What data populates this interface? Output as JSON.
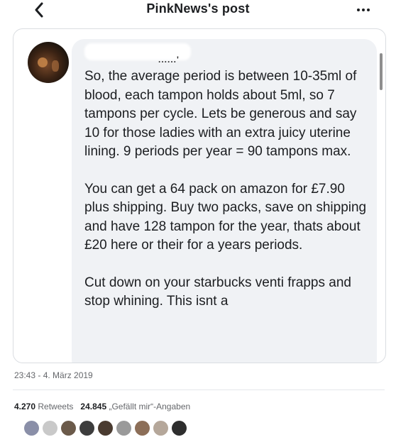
{
  "nav": {
    "back_icon": "chevron-left-icon",
    "title": "PinkNews's post",
    "more_icon": "ellipsis-icon"
  },
  "post": {
    "author_name_visible": "......'",
    "paragraphs": [
      "So, the average period is between 10-35ml of blood, each tampon holds about 5ml, so 7 tampons per cycle. Lets be generous and say 10 for those ladies with an extra juicy uterine lining. 9 periods per year = 90 tampons max.",
      "You can get a 64 pack on amazon for £7.90 plus shipping. Buy two packs, save on shipping and have 128 tampon for the year, thats about £20 here or their for a years periods.",
      "Cut down on your starbucks venti frapps and stop whining. This isnt a"
    ]
  },
  "meta": {
    "timestamp": "23:43 - 4. März 2019",
    "retweets_count": "4.270",
    "retweets_label": "Retweets",
    "likes_count": "24.845",
    "likes_label": "„Gefällt mir“-Angaben"
  },
  "likers": {
    "colors": [
      "#8a8fa8",
      "#c9c9c9",
      "#6b5a4a",
      "#3d3d3d",
      "#4a3b30",
      "#9a9a9a",
      "#8c6e58",
      "#b5a79a",
      "#2e2e2e"
    ]
  }
}
